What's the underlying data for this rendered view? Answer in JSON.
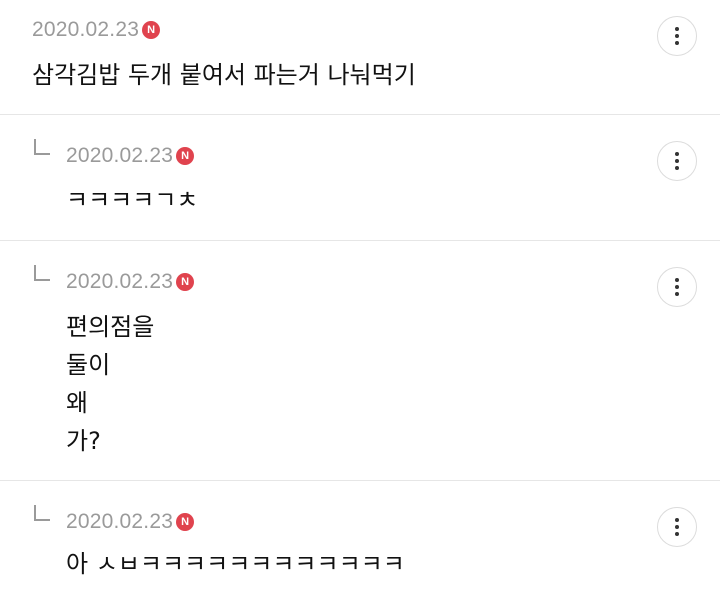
{
  "comments": [
    {
      "date": "2020.02.23",
      "badge": "N",
      "text": "삼각김밥 두개 붙여서 파는거 나눠먹기",
      "is_reply": false
    },
    {
      "date": "2020.02.23",
      "badge": "N",
      "text": "ㅋㅋㅋㅋㄱㅊ",
      "is_reply": true
    },
    {
      "date": "2020.02.23",
      "badge": "N",
      "text": "편의점을\n둘이\n왜\n가?",
      "is_reply": true
    },
    {
      "date": "2020.02.23",
      "badge": "N",
      "text": "아 ㅅㅂㅋㅋㅋㅋㅋㅋㅋㅋㅋㅋㅋㅋ",
      "is_reply": true
    }
  ],
  "icons": {
    "more": "more-vertical-icon",
    "reply": "reply-arrow-icon",
    "new_badge": "new-badge-icon"
  },
  "colors": {
    "badge": "#e0434e",
    "date": "#9a9a9a",
    "divider": "#e6e6e6"
  }
}
